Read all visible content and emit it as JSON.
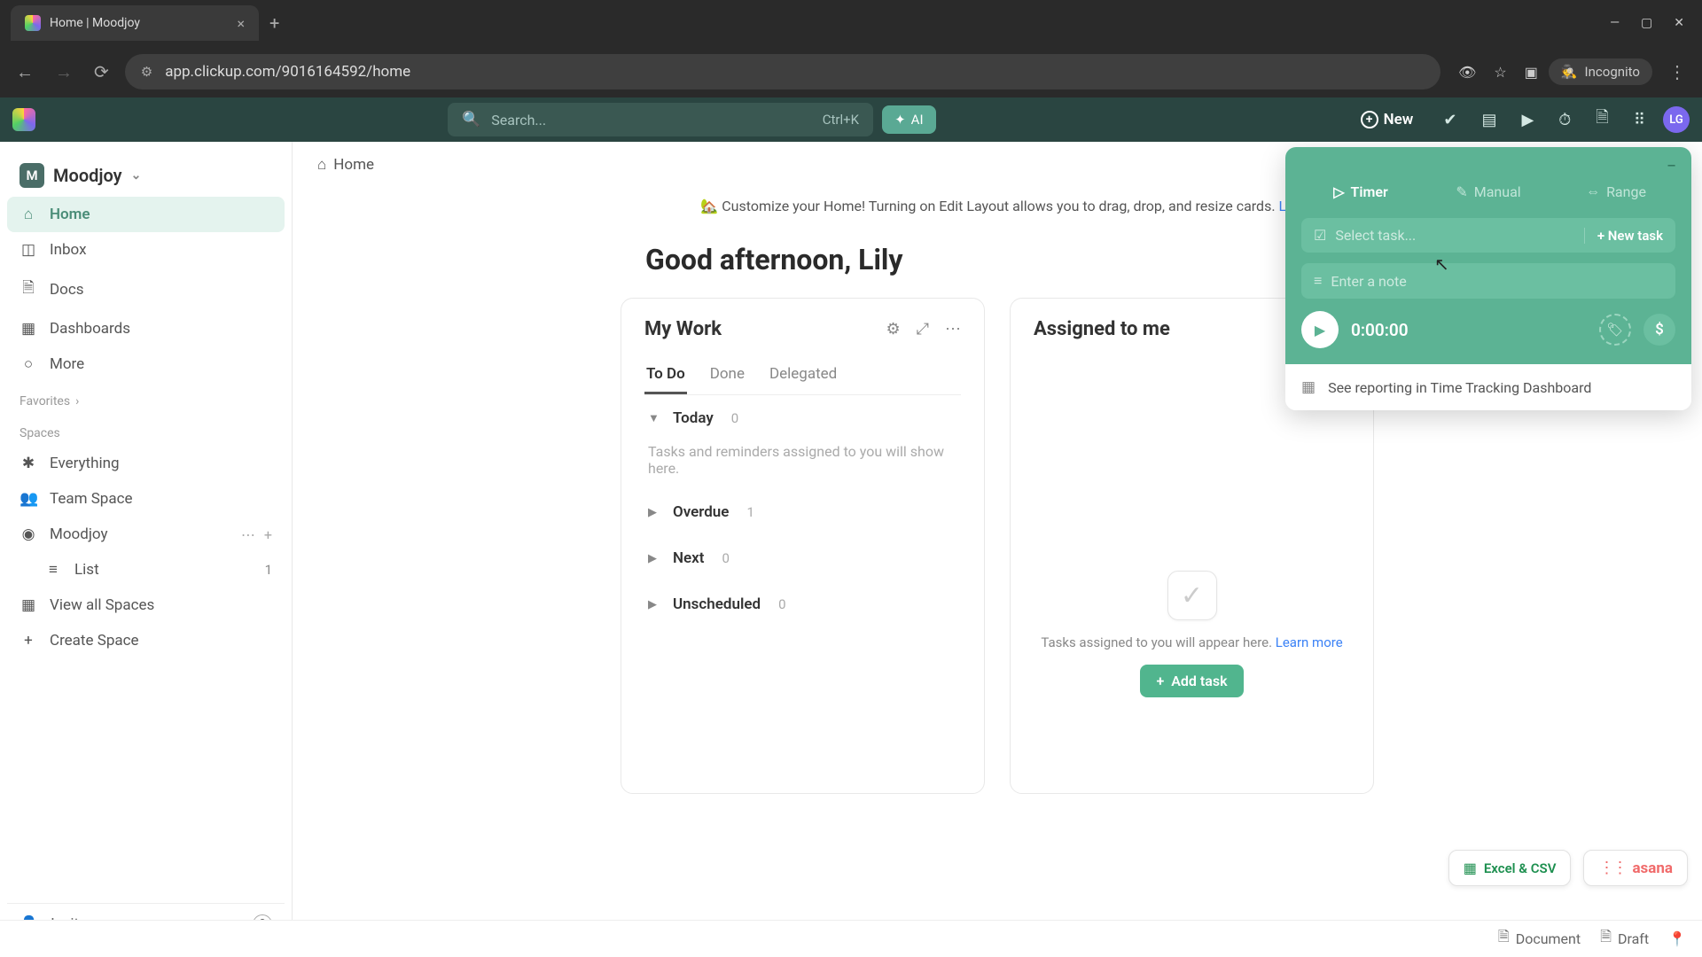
{
  "browser": {
    "tab_title": "Home | Moodjoy",
    "url": "app.clickup.com/9016164592/home",
    "incognito": "Incognito"
  },
  "topbar": {
    "search_placeholder": "Search...",
    "shortcut": "Ctrl+K",
    "ai_label": "AI",
    "new_label": "New",
    "avatar": "LG"
  },
  "sidebar": {
    "workspace": {
      "initial": "M",
      "name": "Moodjoy"
    },
    "nav": {
      "home": "Home",
      "inbox": "Inbox",
      "docs": "Docs",
      "dashboards": "Dashboards",
      "more": "More"
    },
    "favorites_label": "Favorites",
    "spaces_label": "Spaces",
    "spaces": {
      "everything": "Everything",
      "team_space": "Team Space",
      "moodjoy": "Moodjoy",
      "list": "List",
      "list_count": "1",
      "view_all": "View all Spaces",
      "create": "Create Space"
    },
    "footer": {
      "invite": "Invite"
    }
  },
  "content": {
    "breadcrumb": "Home",
    "banner_emoji": "🏡",
    "banner_text": " Customize your Home! Turning on Edit Layout allows you to drag, drop, and resize cards. ",
    "banner_link": "Le",
    "greeting": "Good afternoon, Lily"
  },
  "mywork": {
    "title": "My Work",
    "tabs": {
      "todo": "To Do",
      "done": "Done",
      "delegated": "Delegated"
    },
    "groups": {
      "today": {
        "name": "Today",
        "count": "0"
      },
      "overdue": {
        "name": "Overdue",
        "count": "1"
      },
      "next": {
        "name": "Next",
        "count": "0"
      },
      "unscheduled": {
        "name": "Unscheduled",
        "count": "0"
      }
    },
    "empty": "Tasks and reminders assigned to you will show here."
  },
  "assigned": {
    "title": "Assigned to me",
    "empty_text": "Tasks assigned to you will appear here. ",
    "learn_more": "Learn more",
    "add_task": "Add task"
  },
  "timer": {
    "tabs": {
      "timer": "Timer",
      "manual": "Manual",
      "range": "Range"
    },
    "select_task": "Select task...",
    "new_task": "+ New task",
    "note_placeholder": "Enter a note",
    "time": "0:00:00",
    "dollar": "$",
    "report": "See reporting in Time Tracking Dashboard"
  },
  "imports": {
    "excel": "Excel & CSV",
    "asana": "asana"
  },
  "statusbar": {
    "document": "Document",
    "draft": "Draft"
  }
}
